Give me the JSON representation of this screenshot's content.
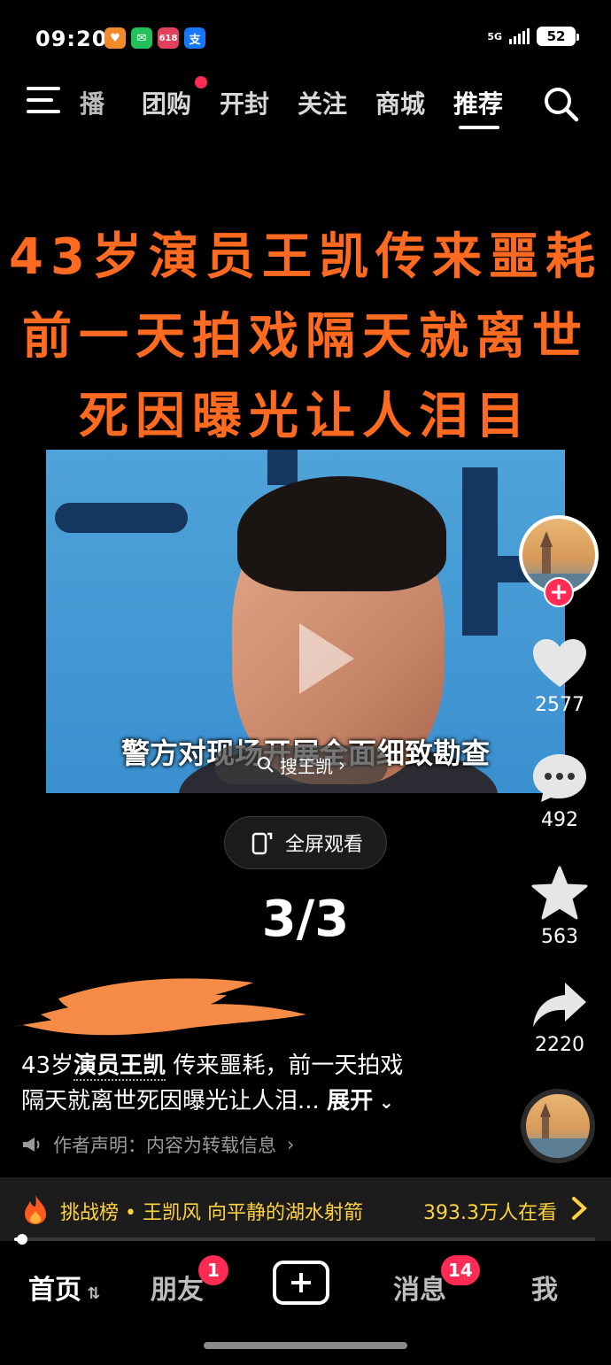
{
  "status_bar": {
    "time": "09:20",
    "network": "5G",
    "battery": "52",
    "app_icons": [
      {
        "name": "heart-app-icon",
        "color": "#f08a2a",
        "glyph": "♥"
      },
      {
        "name": "wechat-icon",
        "color": "#23c15c",
        "glyph": "✉"
      },
      {
        "name": "shopping-618-icon",
        "color": "#e2405b",
        "glyph": "618"
      },
      {
        "name": "alipay-icon",
        "color": "#1677ff",
        "glyph": "支"
      }
    ]
  },
  "top_nav": {
    "tabs": [
      "播",
      "团购",
      "开封",
      "关注",
      "商城",
      "推荐"
    ],
    "active_tab": "推荐"
  },
  "post": {
    "headline": [
      "43岁演员王凯传来噩耗",
      "前一天拍戏隔天就离世",
      "死因曝光让人泪目"
    ],
    "video_subtitle": "警方对现场开展全面细致勘查",
    "search_chip": "搜王凯",
    "fullscreen_label": "全屏观看",
    "page_counter": "3/3",
    "caption_prefix": "43岁",
    "caption_highlight": "演员王凯",
    "caption_rest_line1": "传来噩耗，前一天拍戏",
    "caption_line2": "隔天就离世死因曝光让人泪...",
    "expand_label": "展开",
    "declaration": "作者声明：内容为转载信息"
  },
  "actions": {
    "likes": "2577",
    "comments": "492",
    "favorites": "563",
    "shares": "2220"
  },
  "challenge_bar": {
    "text": "挑战榜 • 王凯风 向平静的湖水射箭",
    "viewers": "393.3万人在看"
  },
  "playback_progress": 0.01,
  "bottom_nav": {
    "home": "首页",
    "friends": "朋友",
    "friends_badge": "1",
    "messages": "消息",
    "messages_badge": "14",
    "me": "我"
  },
  "colors": {
    "headline": "#ff6a21",
    "accent_red": "#fe2c55",
    "challenge_text": "#ffd23f"
  }
}
